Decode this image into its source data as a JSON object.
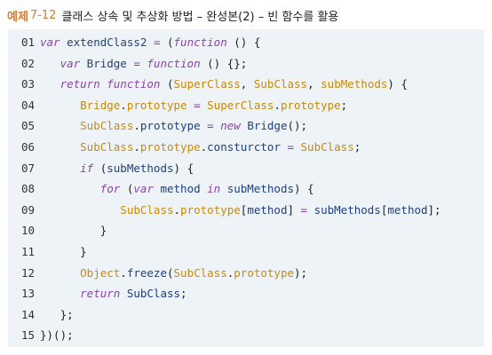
{
  "header": {
    "label": "예제",
    "number": "7-12",
    "title": "클래스 상속 및 추상화 방법 – 완성본(2) – 빈 함수를 활용"
  },
  "code": {
    "indent_unit_ch": 3,
    "lines": [
      {
        "num": "01",
        "indent": 0,
        "tokens": [
          [
            "kw",
            "var "
          ],
          [
            "id",
            "extendClass2"
          ],
          [
            "op",
            " = "
          ],
          [
            "pn",
            "("
          ],
          [
            "kw",
            "function"
          ],
          [
            "pn",
            " () {"
          ]
        ]
      },
      {
        "num": "02",
        "indent": 1,
        "tokens": [
          [
            "kw",
            "var "
          ],
          [
            "id",
            "Bridge"
          ],
          [
            "op",
            " = "
          ],
          [
            "kw",
            "function"
          ],
          [
            "pn",
            " () {};"
          ]
        ]
      },
      {
        "num": "03",
        "indent": 1,
        "tokens": [
          [
            "kw",
            "return "
          ],
          [
            "kw",
            "function"
          ],
          [
            "pn",
            " ("
          ],
          [
            "cn",
            "SuperClass"
          ],
          [
            "pn",
            ", "
          ],
          [
            "cn",
            "SubClass"
          ],
          [
            "pn",
            ", "
          ],
          [
            "cn",
            "subMethods"
          ],
          [
            "pn",
            ") {"
          ]
        ]
      },
      {
        "num": "04",
        "indent": 2,
        "tokens": [
          [
            "cn",
            "Bridge"
          ],
          [
            "pn",
            "."
          ],
          [
            "cn",
            "prototype"
          ],
          [
            "op",
            " = "
          ],
          [
            "cn",
            "SuperClass"
          ],
          [
            "pn",
            "."
          ],
          [
            "cn",
            "prototype"
          ],
          [
            "pn",
            ";"
          ]
        ]
      },
      {
        "num": "05",
        "indent": 2,
        "tokens": [
          [
            "cn",
            "SubClass"
          ],
          [
            "pn",
            "."
          ],
          [
            "id",
            "prototype"
          ],
          [
            "op",
            " = "
          ],
          [
            "kw",
            "new "
          ],
          [
            "id",
            "Bridge"
          ],
          [
            "pn",
            "();"
          ]
        ]
      },
      {
        "num": "06",
        "indent": 2,
        "tokens": [
          [
            "cn",
            "SubClass"
          ],
          [
            "pn",
            "."
          ],
          [
            "cn",
            "prototype"
          ],
          [
            "pn",
            "."
          ],
          [
            "id",
            "consturctor"
          ],
          [
            "op",
            " = "
          ],
          [
            "cn",
            "SubClass"
          ],
          [
            "pn",
            ";"
          ]
        ]
      },
      {
        "num": "07",
        "indent": 2,
        "tokens": [
          [
            "kw",
            "if "
          ],
          [
            "pn",
            "("
          ],
          [
            "id",
            "subMethods"
          ],
          [
            "pn",
            ") {"
          ]
        ]
      },
      {
        "num": "08",
        "indent": 3,
        "tokens": [
          [
            "kw",
            "for "
          ],
          [
            "pn",
            "("
          ],
          [
            "kw",
            "var "
          ],
          [
            "id",
            "method "
          ],
          [
            "kw",
            "in "
          ],
          [
            "id",
            "subMethods"
          ],
          [
            "pn",
            ") {"
          ]
        ]
      },
      {
        "num": "09",
        "indent": 4,
        "tokens": [
          [
            "cn",
            "SubClass"
          ],
          [
            "pn",
            "."
          ],
          [
            "cn",
            "prototype"
          ],
          [
            "pn",
            "["
          ],
          [
            "id",
            "method"
          ],
          [
            "pn",
            "]"
          ],
          [
            "op",
            " = "
          ],
          [
            "id",
            "subMethods"
          ],
          [
            "pn",
            "["
          ],
          [
            "id",
            "method"
          ],
          [
            "pn",
            "];"
          ]
        ]
      },
      {
        "num": "10",
        "indent": 3,
        "tokens": [
          [
            "pn",
            "}"
          ]
        ]
      },
      {
        "num": "11",
        "indent": 2,
        "tokens": [
          [
            "pn",
            "}"
          ]
        ]
      },
      {
        "num": "12",
        "indent": 2,
        "tokens": [
          [
            "cn",
            "Object"
          ],
          [
            "pn",
            "."
          ],
          [
            "id",
            "freeze"
          ],
          [
            "pn",
            "("
          ],
          [
            "cn",
            "SubClass"
          ],
          [
            "pn",
            "."
          ],
          [
            "cn",
            "prototype"
          ],
          [
            "pn",
            ");"
          ]
        ]
      },
      {
        "num": "13",
        "indent": 2,
        "tokens": [
          [
            "kw",
            "return "
          ],
          [
            "id",
            "SubClass"
          ],
          [
            "pn",
            ";"
          ]
        ]
      },
      {
        "num": "14",
        "indent": 1,
        "tokens": [
          [
            "pn",
            "};"
          ]
        ]
      },
      {
        "num": "15",
        "indent": 0,
        "tokens": [
          [
            "pn",
            "})();"
          ]
        ]
      }
    ]
  },
  "colors": {
    "label_orange": "#e07a2c",
    "code_background": "#eef3f8",
    "keyword": "#8a44b0",
    "identifier": "#1e3f84",
    "constant": "#c98a0a"
  }
}
